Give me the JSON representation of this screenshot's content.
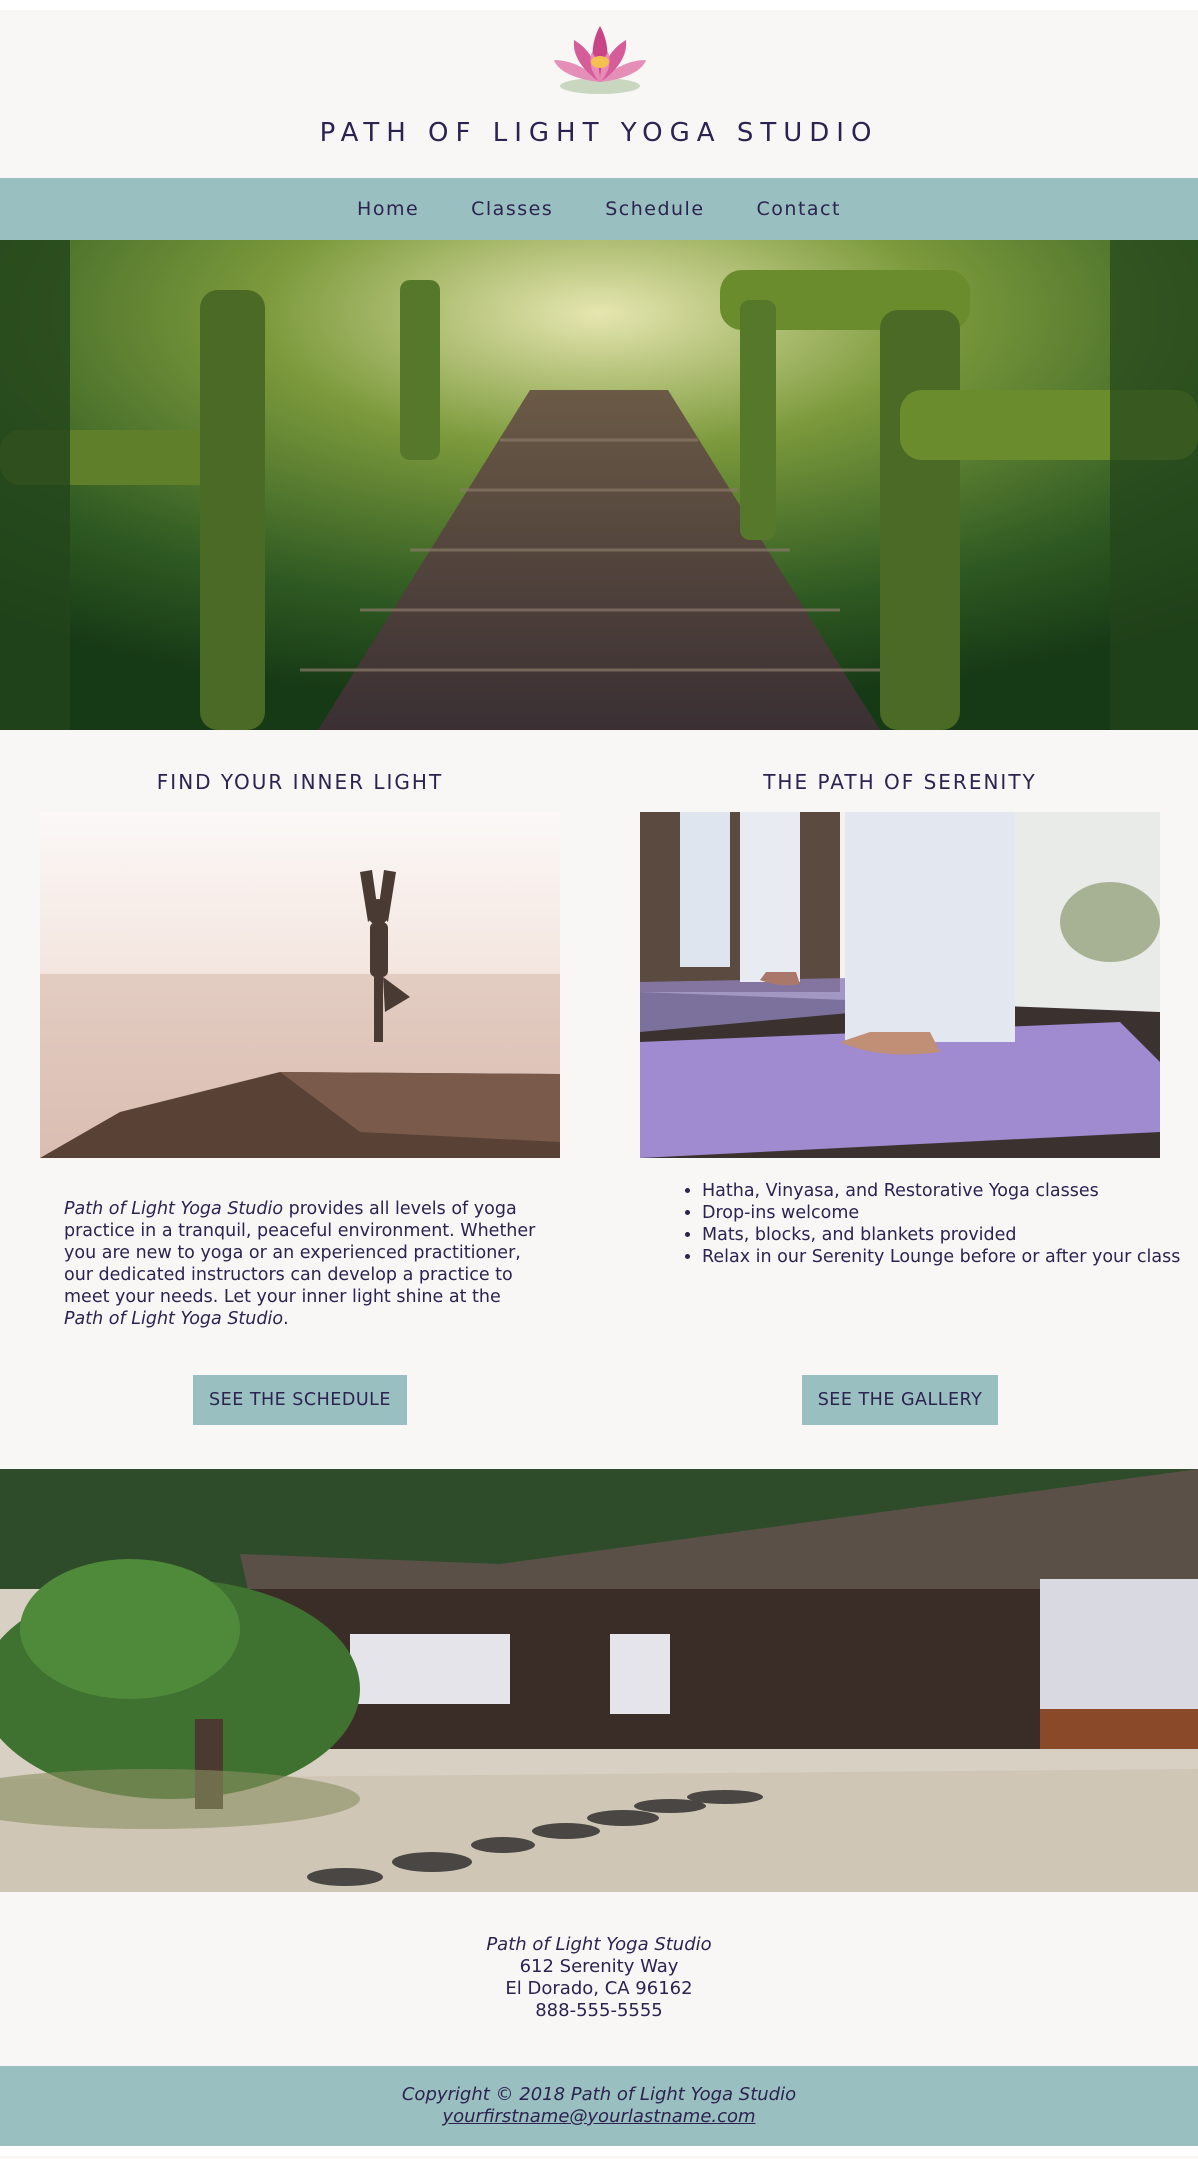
{
  "header": {
    "title": "PATH OF LIGHT YOGA STUDIO",
    "logo_icon": "lotus-flower-icon"
  },
  "nav": {
    "items": [
      "Home",
      "Classes",
      "Schedule",
      "Contact"
    ]
  },
  "hero": {
    "image": "forest-moss-path-photo"
  },
  "left": {
    "heading": "FIND YOUR INNER LIGHT",
    "image": "yoga-pose-seaside-photo",
    "para_name_start": "Path of Light Yoga Studio",
    "para_body": " provides all levels of yoga practice in a tranquil, peaceful environment. Whether you are new to yoga or an experienced practitioner, our dedicated instructors can develop a practice to meet your needs. Let your inner light shine at the ",
    "para_name_end": "Path of Light Yoga Studio",
    "para_end": ".",
    "button": "SEE THE SCHEDULE"
  },
  "right": {
    "heading": "THE PATH OF SERENITY",
    "image": "yoga-mats-feet-photo",
    "features": [
      "Hatha, Vinyasa, and Restorative Yoga classes",
      "Drop-ins welcome",
      "Mats, blocks, and blankets provided",
      "Relax in our Serenity Lounge before or after your class"
    ],
    "button": "SEE THE GALLERY"
  },
  "garden": {
    "image": "japanese-garden-house-photo"
  },
  "address": {
    "name": "Path of Light Yoga Studio",
    "street": "612 Serenity Way",
    "city": "El Dorado, CA 96162",
    "phone": "888-555-5555"
  },
  "footer": {
    "copyright": "Copyright © 2018 Path of Light Yoga Studio",
    "email": "yourfirstname@yourlastname.com"
  },
  "colors": {
    "accent": "#9abfc0",
    "text": "#2c2350",
    "background": "#f8f7f5"
  }
}
